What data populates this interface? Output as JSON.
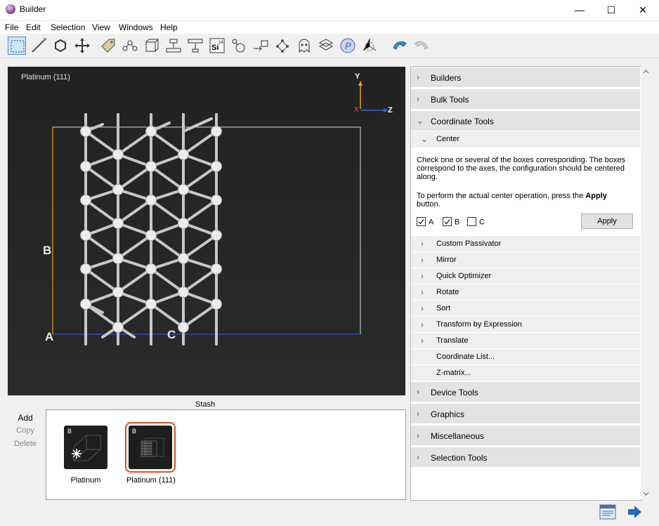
{
  "window": {
    "title": "Builder",
    "minimize": "—",
    "maximize": "☐",
    "close": "✕"
  },
  "menu": [
    "File",
    "Edit",
    "Selection",
    "View",
    "Windows",
    "Help"
  ],
  "viewer": {
    "title": "Platinum (111)",
    "axis_y": "Y",
    "axis_x": "X",
    "axis_z": "Z",
    "label_a": "A",
    "label_b": "B",
    "label_c": "C"
  },
  "stash": {
    "label": "Stash",
    "actions": {
      "add": "Add",
      "copy": "Copy",
      "delete": "Delete"
    },
    "items": [
      {
        "badge": "B",
        "label": "Platinum"
      },
      {
        "badge": "B",
        "label": "Platinum (111)"
      }
    ]
  },
  "panel": {
    "builders": "Builders",
    "bulk_tools": "Bulk Tools",
    "coordinate_tools": "Coordinate Tools",
    "center": {
      "label": "Center",
      "desc1": "Check one or several of the boxes corresponding. The boxes correspond to the axes, the configuration should be centered along.",
      "desc2_pre": "To perform the actual center operation, press the ",
      "desc2_bold": "Apply",
      "desc2_post": "button.",
      "cb_a": "A",
      "cb_b": "B",
      "cb_c": "C",
      "apply": "Apply"
    },
    "subitems": [
      "Custom Passivator",
      "Mirror",
      "Quick Optimizer",
      "Rotate",
      "Sort",
      "Transform by Expression",
      "Translate"
    ],
    "coordinate_list": "Coordinate List...",
    "zmatrix": "Z-matrix...",
    "device_tools": "Device Tools",
    "graphics": "Graphics",
    "miscellaneous": "Miscellaneous",
    "selection_tools": "Selection Tools"
  }
}
